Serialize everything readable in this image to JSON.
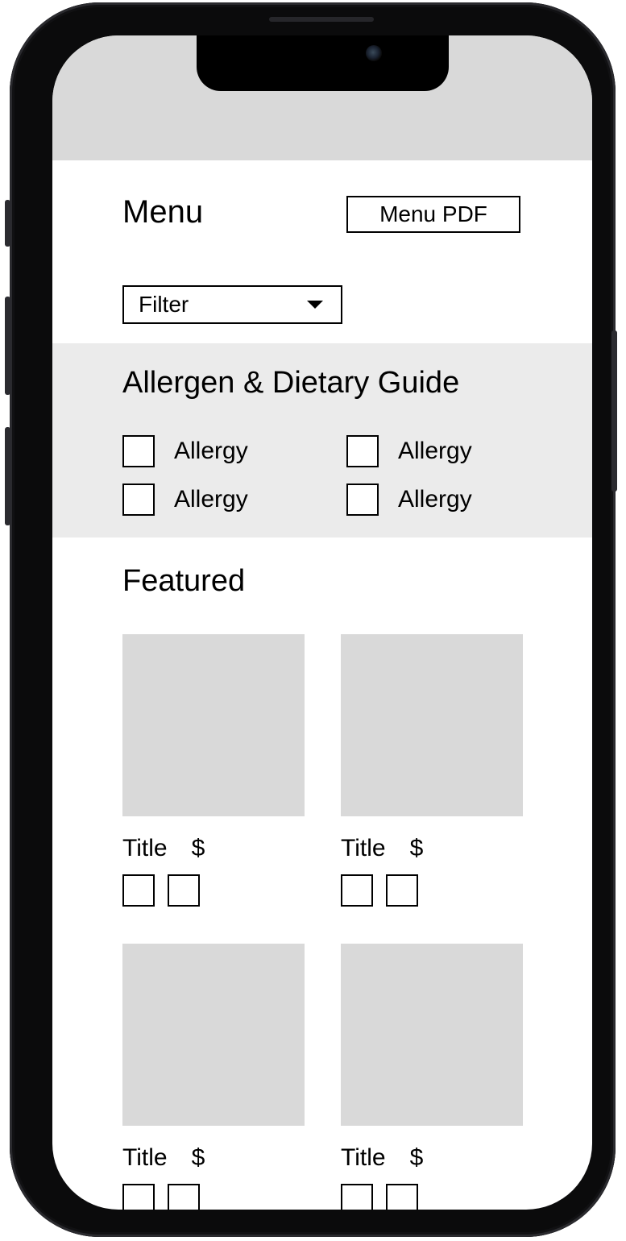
{
  "header": {
    "title": "Menu",
    "pdf_button_label": "Menu PDF"
  },
  "filter": {
    "selected_label": "Filter",
    "icon": "caret-down-icon"
  },
  "allergen_guide": {
    "heading": "Allergen & Dietary Guide",
    "items": [
      {
        "label": "Allergy",
        "checked": false
      },
      {
        "label": "Allergy",
        "checked": false
      },
      {
        "label": "Allergy",
        "checked": false
      },
      {
        "label": "Allergy",
        "checked": false
      }
    ]
  },
  "featured": {
    "heading": "Featured",
    "items": [
      {
        "title": "Title",
        "price": "$"
      },
      {
        "title": "Title",
        "price": "$"
      },
      {
        "title": "Title",
        "price": "$"
      },
      {
        "title": "Title",
        "price": "$"
      }
    ]
  },
  "colors": {
    "placeholder_gray": "#d9d9d9",
    "section_gray": "#ebebeb",
    "frame_black": "#0b0b0c"
  }
}
